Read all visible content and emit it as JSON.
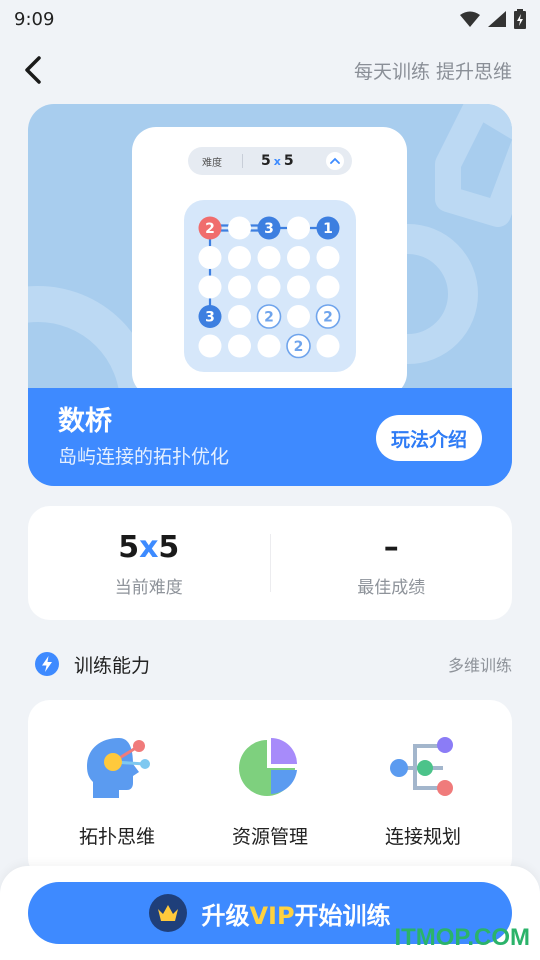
{
  "status": {
    "time": "9:09"
  },
  "nav": {
    "slogan": "每天训练 提升思维"
  },
  "hero": {
    "preview": {
      "difficulty_label": "难度",
      "size_a": "5",
      "times": "x",
      "size_b": "5",
      "numbered_nodes": [
        {
          "row": 0,
          "col": 0,
          "value": "2",
          "kind": "red"
        },
        {
          "row": 0,
          "col": 2,
          "value": "3",
          "kind": "blue"
        },
        {
          "row": 0,
          "col": 4,
          "value": "1",
          "kind": "blue"
        },
        {
          "row": 3,
          "col": 0,
          "value": "3",
          "kind": "blue"
        },
        {
          "row": 3,
          "col": 2,
          "value": "2",
          "kind": "outline"
        },
        {
          "row": 3,
          "col": 4,
          "value": "2",
          "kind": "outline"
        },
        {
          "row": 4,
          "col": 3,
          "value": "2",
          "kind": "outline"
        }
      ]
    },
    "title": "数桥",
    "subtitle": "岛屿连接的拓扑优化",
    "intro_button": "玩法介绍"
  },
  "stats": {
    "current": {
      "value_a": "5",
      "times": "x",
      "value_b": "5",
      "label": "当前难度"
    },
    "best": {
      "value": "–",
      "label": "最佳成绩"
    }
  },
  "section": {
    "title": "训练能力",
    "more": "多维训练"
  },
  "abilities": [
    {
      "label": "拓扑思维",
      "icon": "head-nodes-icon"
    },
    {
      "label": "资源管理",
      "icon": "pie-chart-icon"
    },
    {
      "label": "连接规划",
      "icon": "tree-nodes-icon"
    }
  ],
  "cta": {
    "prefix": "升级",
    "vip": "VIP",
    "suffix": "开始训练"
  },
  "watermark": "ITMOP.COM",
  "colors": {
    "accent": "#3e8aff",
    "vip": "#ffd23f",
    "red_node": "#f06d6d",
    "blue_node": "#3d7fe0"
  }
}
